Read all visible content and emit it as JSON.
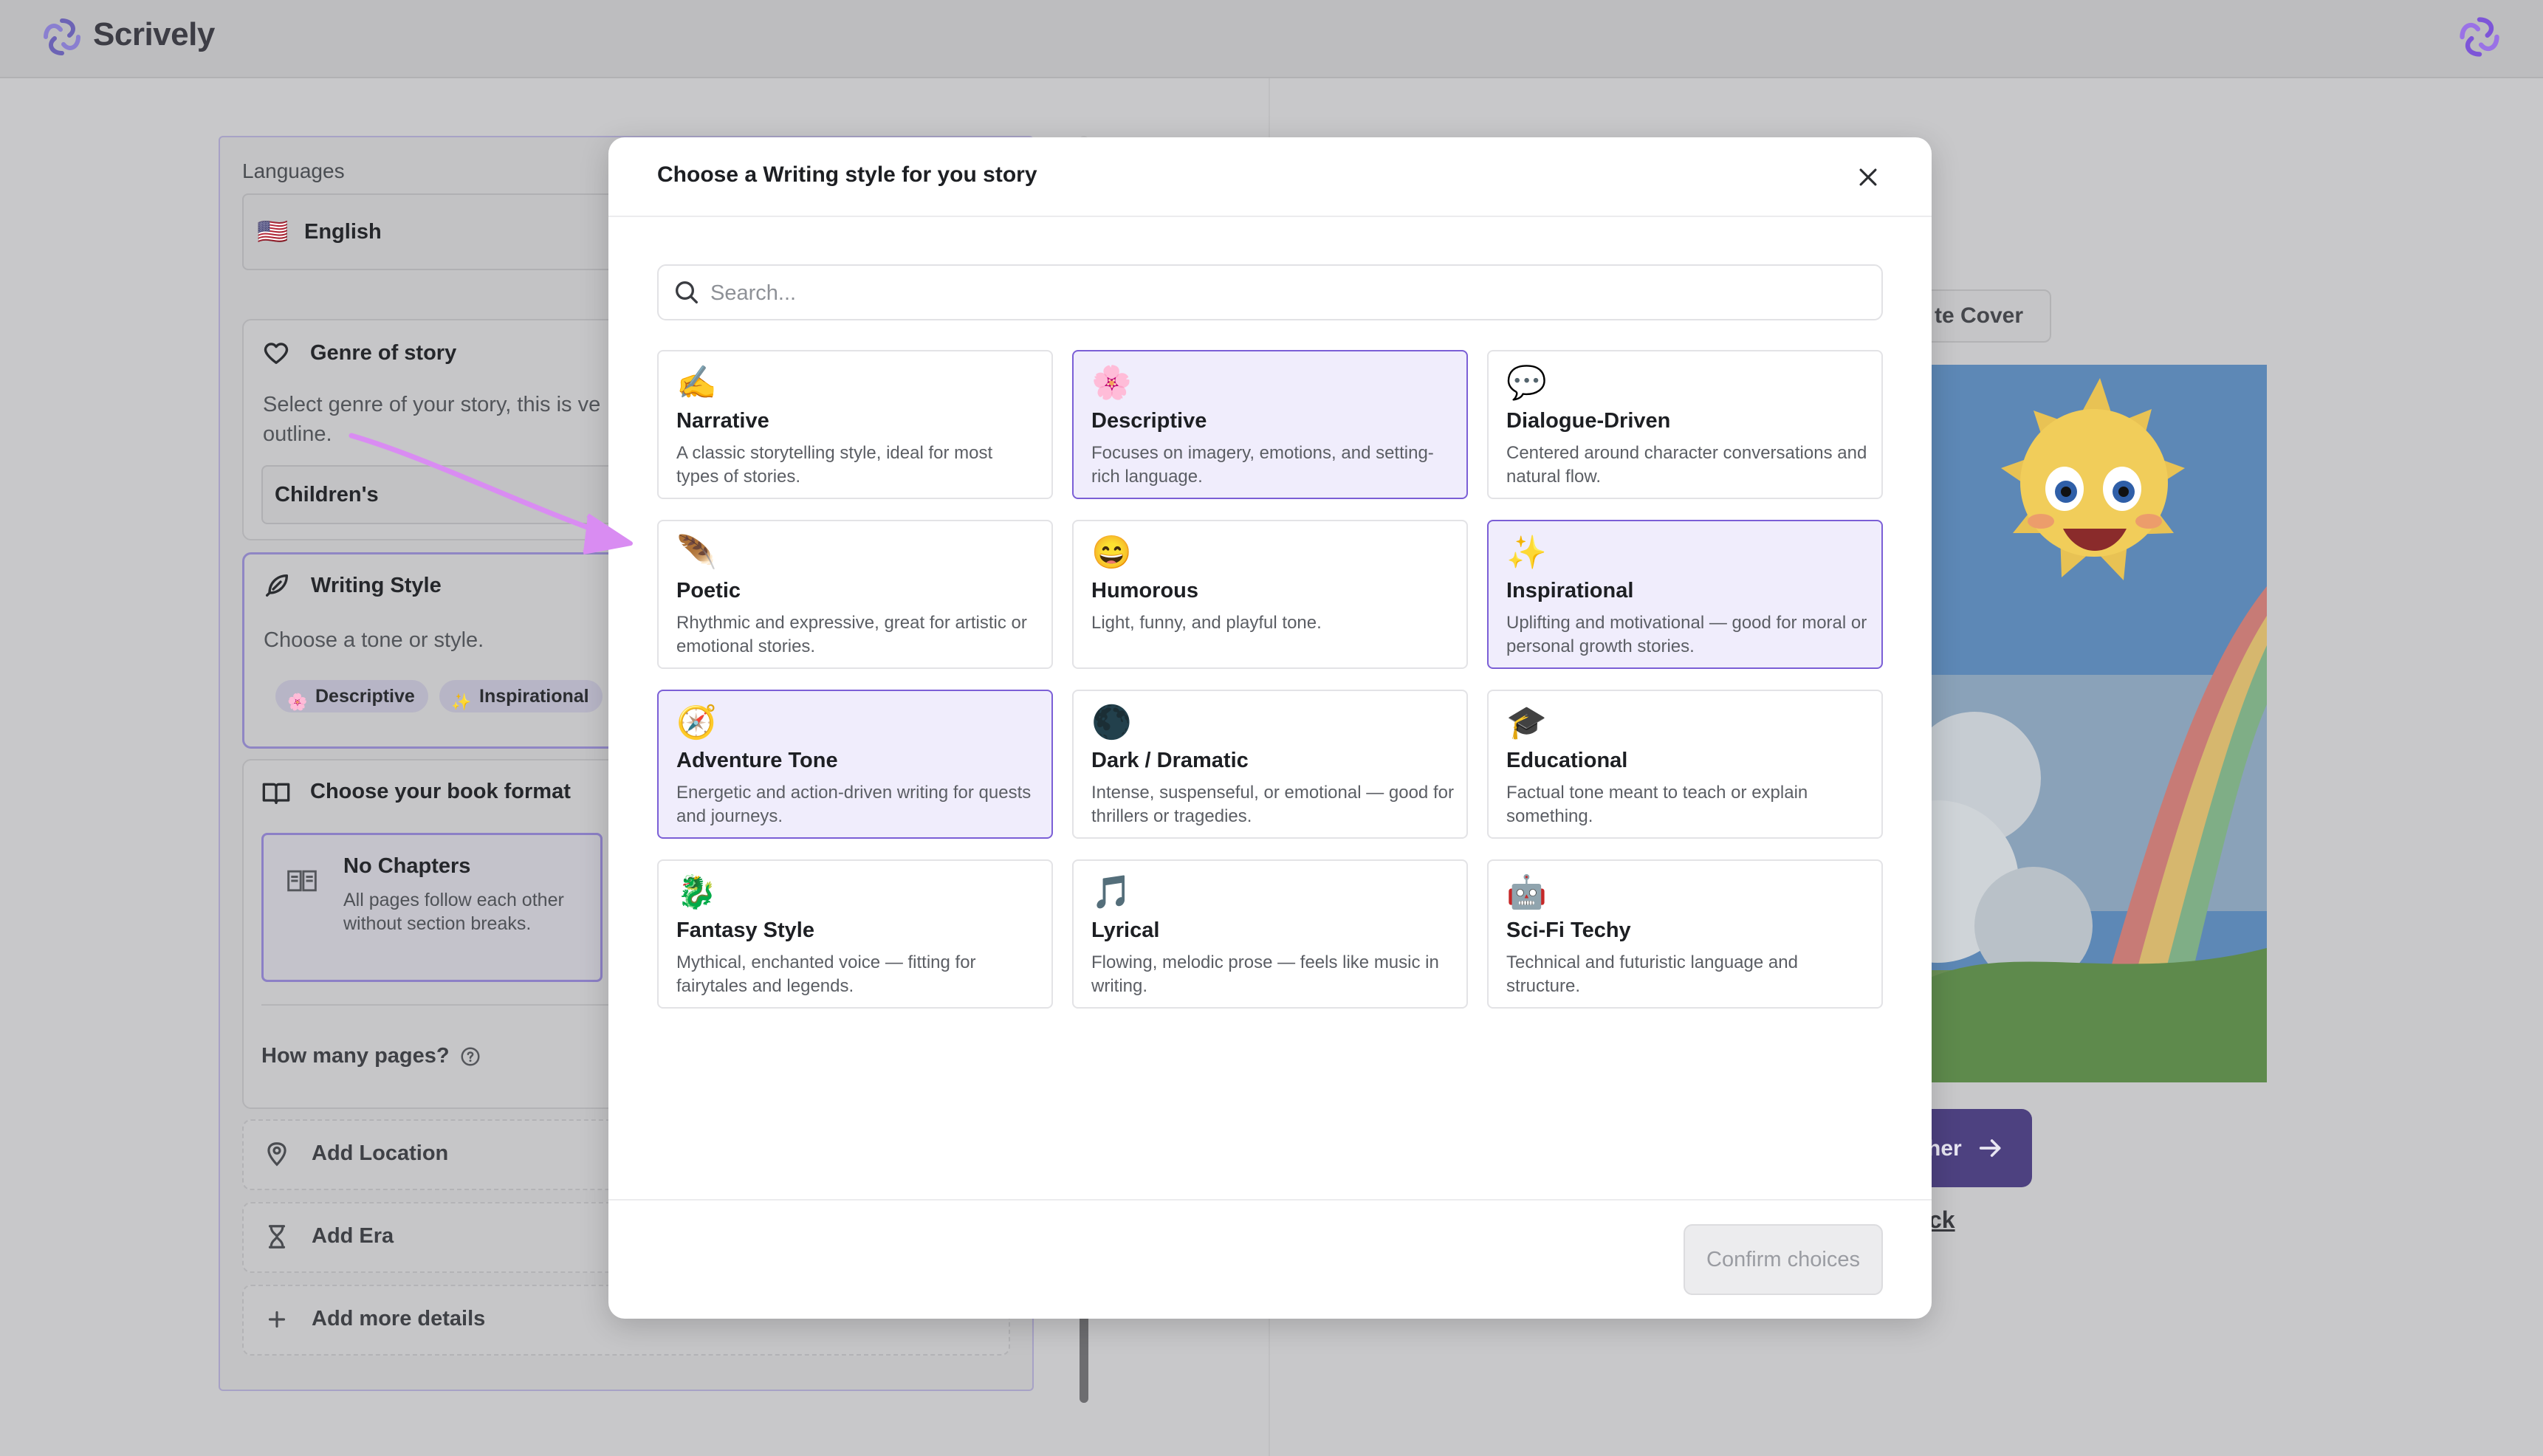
{
  "app": {
    "name": "Scrively"
  },
  "sidebar": {
    "languages_label": "Languages",
    "language_flag": "🇺🇸",
    "language_value": "English",
    "genre": {
      "title": "Genre of story",
      "description_line1": "Select genre of your story, this is ve",
      "description_line2": "outline.",
      "value": "Children's"
    },
    "writing_style": {
      "title": "Writing Style",
      "description": "Choose a tone or style.",
      "chips": [
        {
          "emoji": "🌸",
          "label": "Descriptive"
        },
        {
          "emoji": "✨",
          "label": "Inspirational"
        }
      ]
    },
    "book_format": {
      "title": "Choose your book format",
      "option_title": "No Chapters",
      "option_desc_line1": "All pages follow each other",
      "option_desc_line2": "without section breaks."
    },
    "pages_label": "How many pages?",
    "add_location": "Add Location",
    "add_era": "Add Era",
    "add_more_details": "Add more details"
  },
  "right_panel": {
    "cover_button_label": "te Cover",
    "next_button_label": "her",
    "back_link_label": "ck"
  },
  "modal": {
    "title": "Choose a Writing style for you story",
    "search_placeholder": "Search...",
    "confirm_label": "Confirm choices",
    "styles": [
      {
        "emoji": "✍️",
        "name": "Narrative",
        "desc": "A classic storytelling style, ideal for most types of stories.",
        "selected": false
      },
      {
        "emoji": "🌸",
        "name": "Descriptive",
        "desc": "Focuses on imagery, emotions, and setting-rich language.",
        "selected": true
      },
      {
        "emoji": "💬",
        "name": "Dialogue-Driven",
        "desc": "Centered around character conversations and natural flow.",
        "selected": false
      },
      {
        "emoji": "🪶",
        "name": "Poetic",
        "desc": "Rhythmic and expressive, great for artistic or emotional stories.",
        "selected": false
      },
      {
        "emoji": "😄",
        "name": "Humorous",
        "desc": "Light, funny, and playful tone.",
        "selected": false
      },
      {
        "emoji": "✨",
        "name": "Inspirational",
        "desc": "Uplifting and motivational — good for moral or personal growth stories.",
        "selected": true
      },
      {
        "emoji": "🧭",
        "name": "Adventure Tone",
        "desc": "Energetic and action-driven writing for quests and journeys.",
        "selected": true
      },
      {
        "emoji": "🌑",
        "name": "Dark / Dramatic",
        "desc": "Intense, suspenseful, or emotional — good for thrillers or tragedies.",
        "selected": false
      },
      {
        "emoji": "🎓",
        "name": "Educational",
        "desc": "Factual tone meant to teach or explain something.",
        "selected": false
      },
      {
        "emoji": "🐉",
        "name": "Fantasy Style",
        "desc": "Mythical, enchanted voice — fitting for fairytales and legends.",
        "selected": false
      },
      {
        "emoji": "🎵",
        "name": "Lyrical",
        "desc": "Flowing, melodic prose — feels like music in writing.",
        "selected": false
      },
      {
        "emoji": "🤖",
        "name": "Sci-Fi Techy",
        "desc": "Technical and futuristic language and structure.",
        "selected": false
      }
    ]
  },
  "colors": {
    "accent": "#7b5fd6",
    "selected_bg": "#f0edfc",
    "annotation_arrow": "#d98cf2"
  }
}
